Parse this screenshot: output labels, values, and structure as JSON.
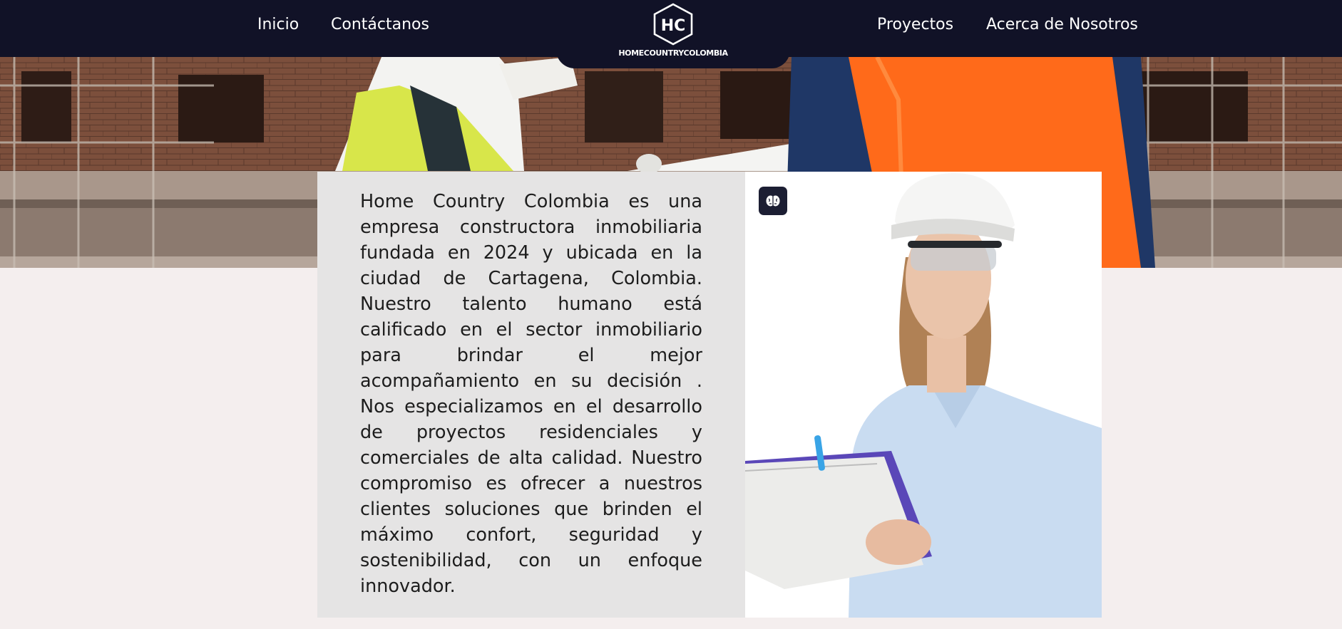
{
  "nav": {
    "left_items": [
      {
        "label": "Inicio"
      },
      {
        "label": "Contáctanos"
      }
    ],
    "right_items": [
      {
        "label": "Proyectos"
      },
      {
        "label": "Acerca de Nosotros"
      }
    ],
    "logo_mark": "HC",
    "logo_text": "HOMECOUNTRYCOLOMBIA"
  },
  "about": {
    "paragraph": "Home Country Colombia es una empresa constructora inmobiliaria fundada en 2024 y ubicada en la ciudad de Cartagena, Colombia. Nuestro talento humano está calificado en el sector inmobiliario para brindar el mejor acompañamiento en su decisión . Nos especializamos en el desarrollo de proyectos residenciales y comerciales de alta calidad. Nuestro compromiso es ofrecer a nuestros clientes soluciones que brinden el máximo confort, seguridad y sostenibilidad, con un enfoque innovador."
  },
  "icons": {
    "logo": "hexagon-logo-icon",
    "brain": "brain-icon"
  },
  "colors": {
    "navbar": "#111227",
    "page_background": "#f4eeee",
    "text_panel": "#e5e4e4",
    "icon_button": "#1c1e33"
  }
}
